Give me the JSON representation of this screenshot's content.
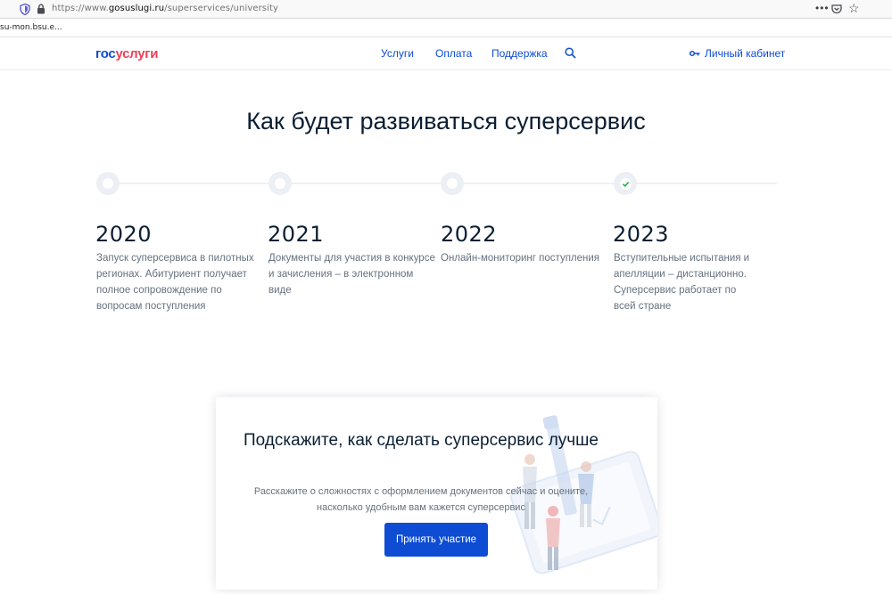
{
  "browser": {
    "url_prefix": "https://www.",
    "url_host": "gosuslugi.ru",
    "url_path": "/superservices/university",
    "tab_label": "su-mon.bsu.e..."
  },
  "header": {
    "logo_part1": "гос",
    "logo_part2": "услуги",
    "nav": [
      "Услуги",
      "Оплата",
      "Поддержка"
    ],
    "cabinet_label": "Личный кабинет"
  },
  "main": {
    "title": "Как будет развиваться суперсервис",
    "timeline": [
      {
        "year": "2020",
        "text": "Запуск суперсервиса в пилотных регионах. Абитуриент получает полное сопровождение по вопросам поступления",
        "status": "pending"
      },
      {
        "year": "2021",
        "text": "Документы для участия в конкурсе и зачисления – в электронном виде",
        "status": "pending"
      },
      {
        "year": "2022",
        "text": "Онлайн-мониторинг поступления",
        "status": "pending"
      },
      {
        "year": "2023",
        "text": "Вступительные испытания и апелляции – дистанционно. Суперсервис работает по всей стране",
        "status": "done"
      }
    ]
  },
  "feedback": {
    "title": "Подскажите, как сделать суперсервис лучше",
    "text": "Расскажите о сложностях с оформлением документов сейчас и оцените, насколько удобным вам кажется суперсервис",
    "button_label": "Принять участие"
  },
  "colors": {
    "brand_blue": "#0d4cd3",
    "brand_red": "#ee3f58",
    "check_green": "#28b04d"
  }
}
